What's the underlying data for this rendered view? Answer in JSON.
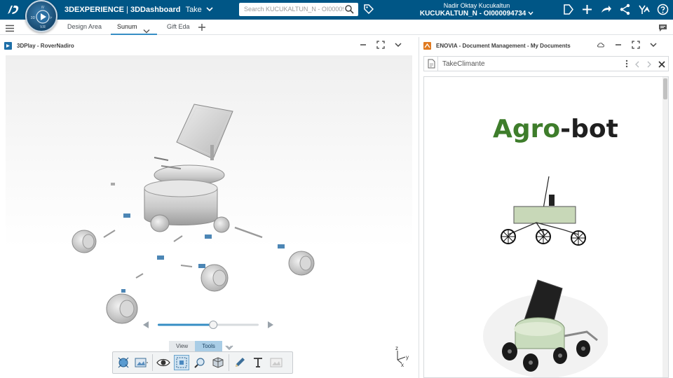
{
  "topbar": {
    "brand": "3DEXPERIENCE",
    "separator": " | ",
    "app": "3DDashboard",
    "context": "Take",
    "compass_label": "V.R",
    "compass_3d": "3D",
    "search_placeholder": "Search KUCUKALTUN_N - OI0000947",
    "user_name": "Nadir Oktay Kucukaltun",
    "user_id": "KUCUKALTUN_N - OI000094734"
  },
  "tabs": [
    {
      "label": "Design Area"
    },
    {
      "label": "Sunum"
    },
    {
      "label": "Gift Eda"
    }
  ],
  "left_panel": {
    "title": "3DPlay - RoverNadiro",
    "toolbar_tabs": [
      "View",
      "Tools"
    ],
    "axis_labels": {
      "z": "z",
      "y": "y",
      "x": "x"
    },
    "slider": {
      "value": 0.55
    }
  },
  "right_panel": {
    "title": "ENOVIA - Document Management - My Documents",
    "document_name": "TakeClimante",
    "doc_title_part1": "Agro",
    "doc_title_part2": "-bot"
  },
  "colors": {
    "topbar": "#005686",
    "accent": "#368ec4",
    "agro_green": "#3e7d2b"
  }
}
